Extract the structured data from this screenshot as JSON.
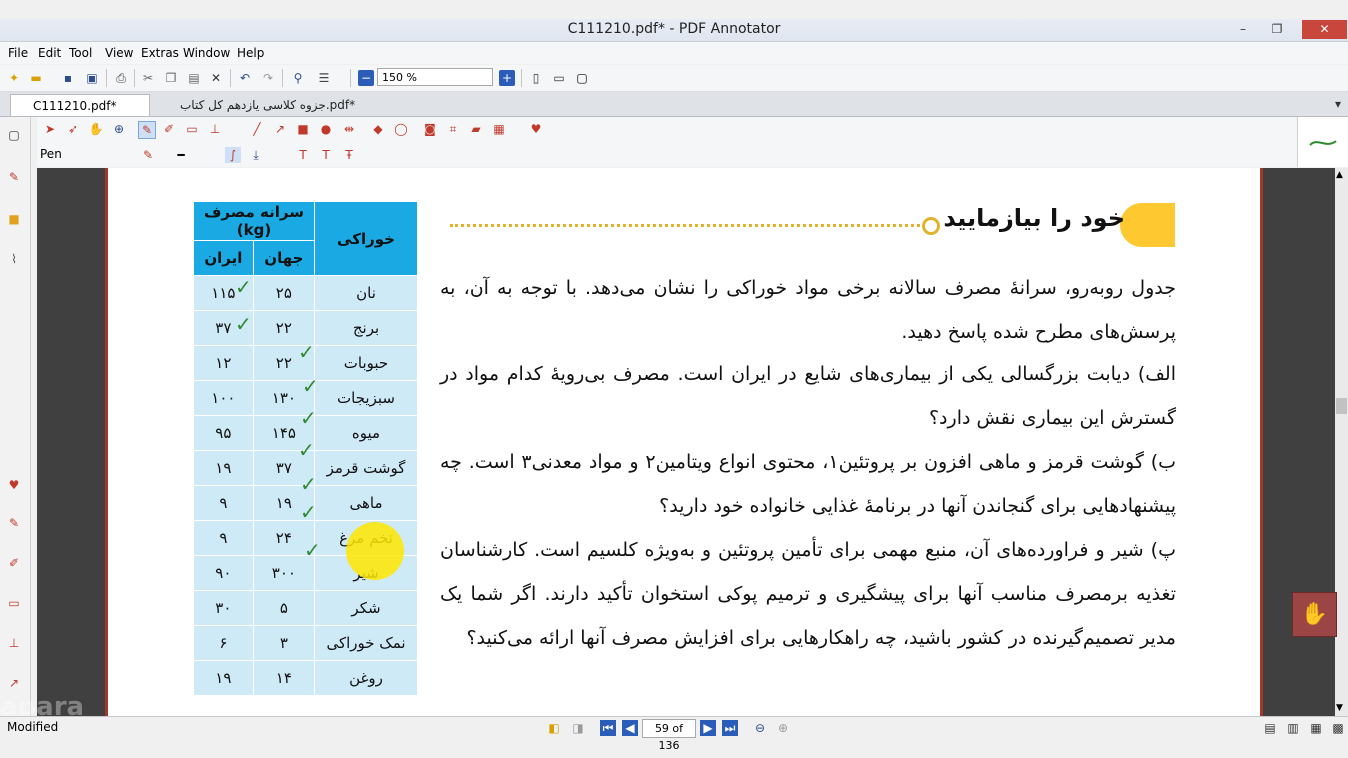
{
  "window": {
    "title": "C111210.pdf* - PDF Annotator",
    "min": "–",
    "max": "❐",
    "close": "✕"
  },
  "menu": [
    "File",
    "Edit",
    "Tool",
    "View",
    "Extras",
    "Window",
    "Help"
  ],
  "toolbar": {
    "zoom": "150 %"
  },
  "tabs": [
    {
      "label": "C111210.pdf*"
    },
    {
      "label": "جزوه کلاسی یازدهم کل کتاب.pdf*"
    }
  ],
  "annot_toolbar": {
    "tool_name": "Pen"
  },
  "status": {
    "text": "Modified",
    "page": "59 of 136"
  },
  "watermark": "apara",
  "colors": {
    "accent": "#1aa9e3",
    "heading": "#fdc830",
    "check": "#2e8b30",
    "highlight": "#ffe600"
  },
  "document": {
    "heading": "خود را بیازمایید",
    "table": {
      "col_food": "خوراکی",
      "col_per_capita": "سرانه مصرف (kg)",
      "col_world": "جهان",
      "col_iran": "ایران",
      "rows": [
        {
          "food": "نان",
          "world": "۲۵",
          "iran": "۱۱۵"
        },
        {
          "food": "برنج",
          "world": "۲۲",
          "iran": "۳۷"
        },
        {
          "food": "حبوبات",
          "world": "۲۲",
          "iran": "۱۲"
        },
        {
          "food": "سبزیجات",
          "world": "۱۳۰",
          "iran": "۱۰۰"
        },
        {
          "food": "میوه",
          "world": "۱۴۵",
          "iran": "۹۵"
        },
        {
          "food": "گوشت قرمز",
          "world": "۳۷",
          "iran": "۱۹"
        },
        {
          "food": "ماهی",
          "world": "۱۹",
          "iran": "۹"
        },
        {
          "food": "تخم مرغ",
          "world": "۲۴",
          "iran": "۹"
        },
        {
          "food": "شیر",
          "world": "۳۰۰",
          "iran": "۹۰"
        },
        {
          "food": "شکر",
          "world": "۵",
          "iran": "۳۰"
        },
        {
          "food": "نمک خوراکی",
          "world": "۳",
          "iran": "۶"
        },
        {
          "food": "روغن",
          "world": "۱۴",
          "iran": "۱۹"
        }
      ]
    },
    "paragraphs": [
      "جدول روبه‌رو، سرانهٔ مصرف سالانه برخی مواد خوراکی را نشان می‌دهد. با توجه به آن، به پرسش‌های مطرح شده پاسخ دهید.",
      "الف) دیابت بزرگسالی یکی از بیماری‌های شایع در ایران است. مصرف بی‌رویهٔ کدام مواد در گسترش این بیماری نقش دارد؟",
      "ب) گوشت قرمز و ماهی افزون بر پروتئین۱، محتوی انواع ویتامین۲ و مواد معدنی۳ است. چه پیشنهادهایی برای گنجاندن آنها در برنامهٔ غذایی خانواده خود دارید؟",
      "پ) شیر و فراورده‌های آن، منبع مهمی برای تأمین پروتئین و به‌ویژه کلسیم است. کارشناسان تغذیه برمصرف مناسب آنها برای پیشگیری و ترمیم پوکی استخوان تأکید دارند. اگر شما یک مدیر تصمیم‌گیرنده در کشور باشید، چه راهکارهایی برای افزایش مصرف آنها ارائه می‌کنید؟"
    ]
  }
}
